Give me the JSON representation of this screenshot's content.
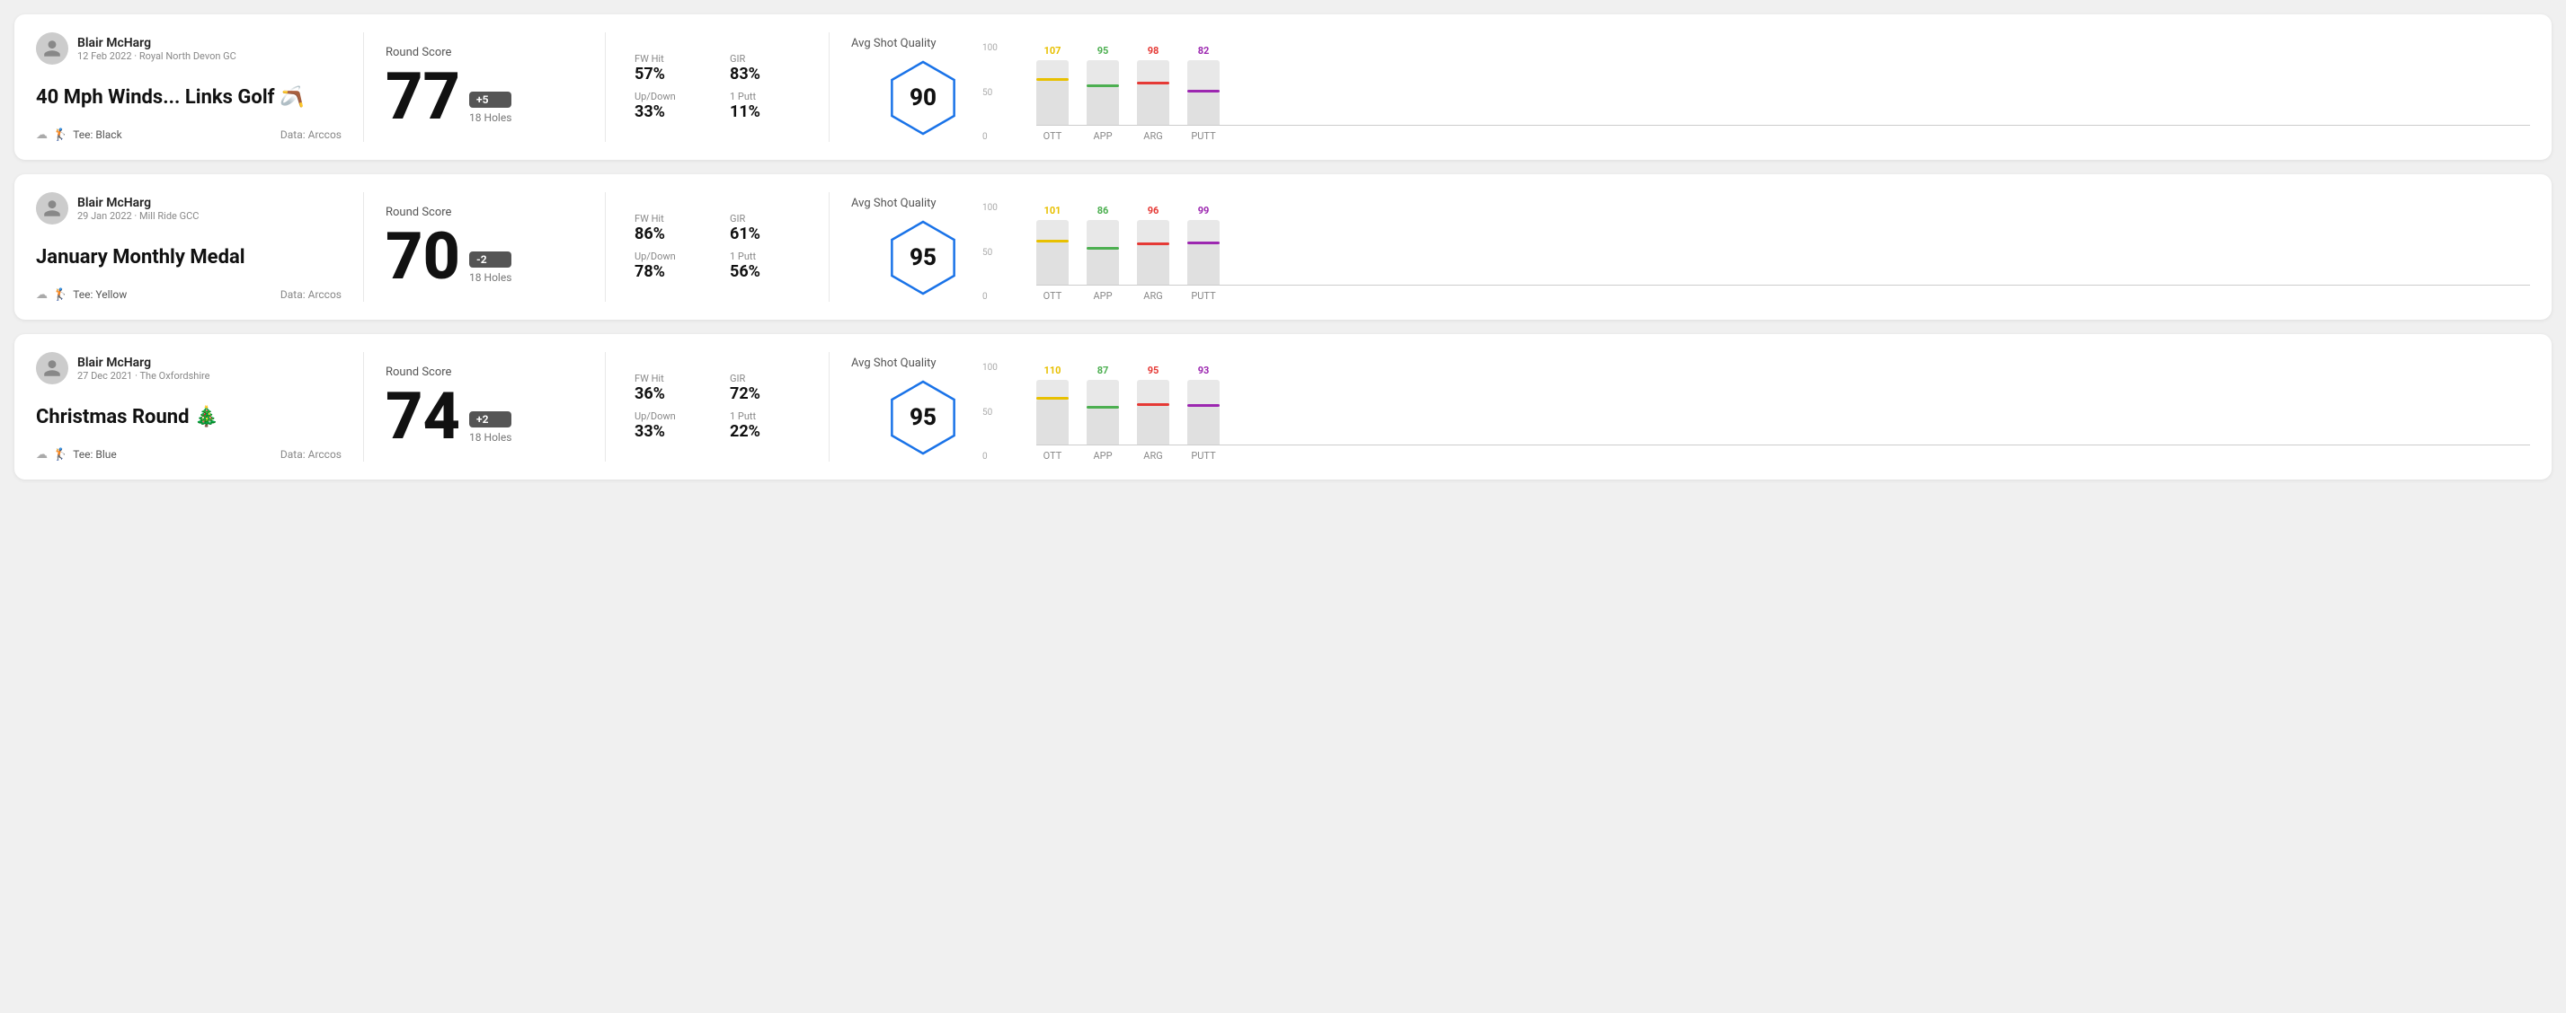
{
  "rounds": [
    {
      "id": "round1",
      "user": {
        "name": "Blair McHarg",
        "date_course": "12 Feb 2022 · Royal North Devon GC"
      },
      "title": "40 Mph Winds... Links Golf 🪃",
      "tee": "Black",
      "data_source": "Data: Arccos",
      "round_score_label": "Round Score",
      "score": "77",
      "badge": "+5",
      "badge_type": "positive",
      "holes": "18 Holes",
      "fw_hit_label": "FW Hit",
      "fw_hit_value": "57%",
      "gir_label": "GIR",
      "gir_value": "83%",
      "updown_label": "Up/Down",
      "updown_value": "33%",
      "oneputt_label": "1 Putt",
      "oneputt_value": "11%",
      "avg_quality_label": "Avg Shot Quality",
      "quality_score": "90",
      "chart": {
        "bars": [
          {
            "label": "OTT",
            "value": 107,
            "color": "#e8c000",
            "pct": 68
          },
          {
            "label": "APP",
            "value": 95,
            "color": "#4caf50",
            "pct": 58
          },
          {
            "label": "ARG",
            "value": 98,
            "color": "#e53935",
            "pct": 62
          },
          {
            "label": "PUTT",
            "value": 82,
            "color": "#9c27b0",
            "pct": 50
          }
        ],
        "y_labels": [
          "100",
          "50",
          "0"
        ]
      }
    },
    {
      "id": "round2",
      "user": {
        "name": "Blair McHarg",
        "date_course": "29 Jan 2022 · Mill Ride GCC"
      },
      "title": "January Monthly Medal",
      "tee": "Yellow",
      "data_source": "Data: Arccos",
      "round_score_label": "Round Score",
      "score": "70",
      "badge": "-2",
      "badge_type": "negative",
      "holes": "18 Holes",
      "fw_hit_label": "FW Hit",
      "fw_hit_value": "86%",
      "gir_label": "GIR",
      "gir_value": "61%",
      "updown_label": "Up/Down",
      "updown_value": "78%",
      "oneputt_label": "1 Putt",
      "oneputt_value": "56%",
      "avg_quality_label": "Avg Shot Quality",
      "quality_score": "95",
      "chart": {
        "bars": [
          {
            "label": "OTT",
            "value": 101,
            "color": "#e8c000",
            "pct": 65
          },
          {
            "label": "APP",
            "value": 86,
            "color": "#4caf50",
            "pct": 54
          },
          {
            "label": "ARG",
            "value": 96,
            "color": "#e53935",
            "pct": 61
          },
          {
            "label": "PUTT",
            "value": 99,
            "color": "#9c27b0",
            "pct": 63
          }
        ],
        "y_labels": [
          "100",
          "50",
          "0"
        ]
      }
    },
    {
      "id": "round3",
      "user": {
        "name": "Blair McHarg",
        "date_course": "27 Dec 2021 · The Oxfordshire"
      },
      "title": "Christmas Round 🎄",
      "tee": "Blue",
      "data_source": "Data: Arccos",
      "round_score_label": "Round Score",
      "score": "74",
      "badge": "+2",
      "badge_type": "positive",
      "holes": "18 Holes",
      "fw_hit_label": "FW Hit",
      "fw_hit_value": "36%",
      "gir_label": "GIR",
      "gir_value": "72%",
      "updown_label": "Up/Down",
      "updown_value": "33%",
      "oneputt_label": "1 Putt",
      "oneputt_value": "22%",
      "avg_quality_label": "Avg Shot Quality",
      "quality_score": "95",
      "chart": {
        "bars": [
          {
            "label": "OTT",
            "value": 110,
            "color": "#e8c000",
            "pct": 70
          },
          {
            "label": "APP",
            "value": 87,
            "color": "#4caf50",
            "pct": 55
          },
          {
            "label": "ARG",
            "value": 95,
            "color": "#e53935",
            "pct": 60
          },
          {
            "label": "PUTT",
            "value": 93,
            "color": "#9c27b0",
            "pct": 59
          }
        ],
        "y_labels": [
          "100",
          "50",
          "0"
        ]
      }
    }
  ],
  "labels": {
    "tee_prefix": "Tee:"
  }
}
